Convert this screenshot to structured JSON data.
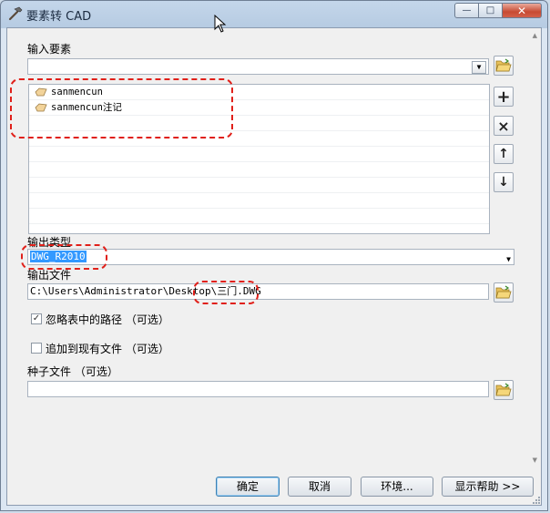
{
  "window": {
    "title": "要素转 CAD",
    "close_glyph": "✕",
    "max_glyph": "□",
    "min_glyph": "—"
  },
  "input_features": {
    "label": "输入要素",
    "value": "",
    "items": [
      {
        "name": "sanmencun"
      },
      {
        "name": "sanmencun注记"
      }
    ]
  },
  "list_buttons": {
    "add": "+",
    "remove": "×",
    "up": "↑",
    "down": "↓"
  },
  "output_type": {
    "label": "输出类型",
    "value": "DWG_R2010"
  },
  "output_file": {
    "label": "输出文件",
    "path_prefix": "C:\\Users\\Administrator\\Desktop\\",
    "path_suffix": "三门.DWG"
  },
  "options": {
    "ignore_paths": {
      "label": "忽略表中的路径 （可选）",
      "checked": true
    },
    "append": {
      "label": "追加到现有文件 （可选）",
      "checked": false
    }
  },
  "seed_file": {
    "label": "种子文件 （可选）",
    "value": ""
  },
  "footer": {
    "ok": "确定",
    "cancel": "取消",
    "env": "环境...",
    "help": "显示帮助 >>"
  },
  "colors": {
    "annotation": "#e0201a",
    "selection": "#3399ff"
  }
}
